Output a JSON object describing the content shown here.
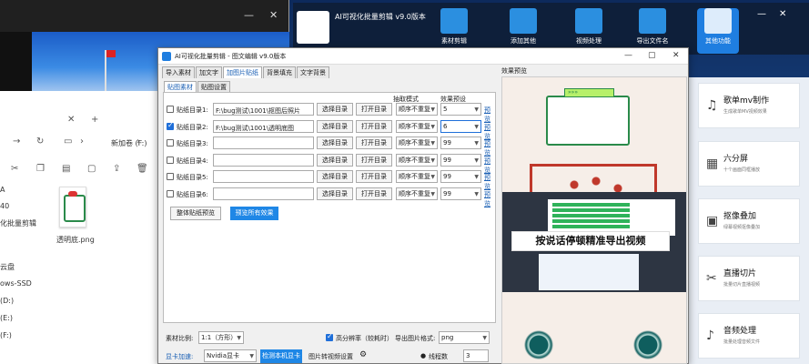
{
  "left_window": {
    "explorer": {
      "path": "新加卷 (F:)",
      "file_name": "透明底.png",
      "side_items": [
        "40",
        "化批量剪辑",
        "云盘",
        "ows-SSD",
        "(D:)",
        "(E:)",
        "(F:)"
      ],
      "side_prefix": "A"
    }
  },
  "app": {
    "title": "AI可视化批量剪辑 v9.0版本",
    "tools": [
      {
        "label": "素材剪辑"
      },
      {
        "label": "添加其他"
      },
      {
        "label": "视频处理"
      },
      {
        "label": "导出文件名"
      },
      {
        "label": "其他功能"
      }
    ],
    "features": [
      {
        "title": "歌单mv制作",
        "sub": "生成歌单MV视频效果"
      },
      {
        "title": "六分屏",
        "sub": "十个画面同框播放"
      },
      {
        "title": "抠像叠加",
        "sub": "绿幕视频抠像叠加"
      },
      {
        "title": "直播切片",
        "sub": "批量切片直播视频"
      },
      {
        "title": "音频处理",
        "sub": "批量处理音频文件"
      }
    ]
  },
  "dialog": {
    "title": "AI可视化批量剪辑 - 图文编辑  v9.0版本",
    "tabs": [
      "导入素材",
      "加文字",
      "加图片贴纸",
      "背景填充",
      "文字背景"
    ],
    "active_tab": "加图片贴纸",
    "subtabs": [
      "贴图素材",
      "贴图设置"
    ],
    "headers": {
      "mode": "抽取模式",
      "effect": "效果预设"
    },
    "rows": [
      {
        "label": "贴纸目录1:",
        "checked": false,
        "path": "F:\\bug测试\\1001\\抠图后照片",
        "btn_select": "选择目录",
        "btn_open": "打开目录",
        "mode": "顺序不重复",
        "effect": "5",
        "preview": "预览"
      },
      {
        "label": "贴纸目录2:",
        "checked": true,
        "path": "F:\\bug测试\\1001\\透明底图",
        "btn_select": "选择目录",
        "btn_open": "打开目录",
        "mode": "顺序不重复",
        "effect": "6",
        "preview": "预览"
      },
      {
        "label": "贴纸目录3:",
        "checked": false,
        "path": "",
        "btn_select": "选择目录",
        "btn_open": "打开目录",
        "mode": "顺序不重复",
        "effect": "99",
        "preview": "预览"
      },
      {
        "label": "贴纸目录4:",
        "checked": false,
        "path": "",
        "btn_select": "选择目录",
        "btn_open": "打开目录",
        "mode": "顺序不重复",
        "effect": "99",
        "preview": "预览"
      },
      {
        "label": "贴纸目录5:",
        "checked": false,
        "path": "",
        "btn_select": "选择目录",
        "btn_open": "打开目录",
        "mode": "顺序不重复",
        "effect": "99",
        "preview": "预览"
      },
      {
        "label": "贴纸目录6:",
        "checked": false,
        "path": "",
        "btn_select": "选择目录",
        "btn_open": "打开目录",
        "mode": "顺序不重复",
        "effect": "99",
        "preview": "预览"
      }
    ],
    "btn_overall_preview": "整体贴纸预览",
    "btn_preview_all": "预览所有效果",
    "preview_label": "效果预览",
    "preview_caption": "按说话停顿精准导出视频",
    "preview_sign": "»»»",
    "bottom": {
      "ratio_label": "素材比例:",
      "ratio_value": "1:1（方形）",
      "hq_label": "高分辨率（较耗时）",
      "hq_checked": true,
      "export_fmt_label": "导出图片格式:",
      "export_fmt_value": "png",
      "gpu_label": "显卡加速:",
      "gpu_value": "Nvidia显卡",
      "gpu_detect": "检测本机显卡",
      "img_video_label": "图片转视频设置",
      "threads_label": "线程数",
      "threads_value": "3"
    }
  }
}
